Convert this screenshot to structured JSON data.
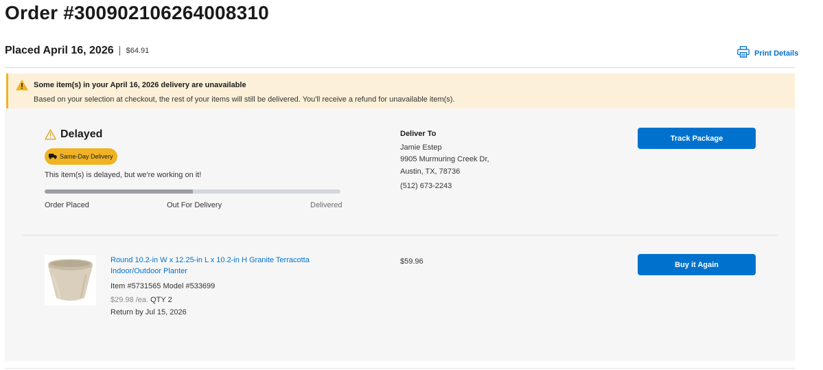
{
  "order": {
    "title": "Order #300902106264008310",
    "placed": "Placed April 16, 2026",
    "total": "$64.91",
    "print_label": "Print Details"
  },
  "banner": {
    "title": "Some item(s) in your April 16, 2026 delivery are unavailable",
    "message": "Based on your selection at checkout, the rest of your items will still be delivered. You'll receive a refund for unavailable item(s)."
  },
  "shipment": {
    "status": "Delayed",
    "badge": "Same-Day Delivery",
    "message": "This item(s) is delayed, but we're working on it!",
    "progress_fraction": 0.5,
    "steps": [
      "Order Placed",
      "Out For Delivery",
      "Delivered"
    ],
    "track_button": "Track Package"
  },
  "deliver_to": {
    "heading": "Deliver To",
    "name": "Jamie Estep",
    "street": "9905 Murmuring Creek Dr,",
    "city": "Austin, TX, 78736",
    "phone": "(512) 673-2243"
  },
  "item": {
    "title": "Round 10.2-in W x 12.25-in L x 10.2-in H Granite Terracotta Indoor/Outdoor Planter",
    "ids": "Item #5731565 Model #533699",
    "unit_price": "$29.98 /ea.",
    "qty": "QTY 2",
    "return_by": "Return by Jul 15, 2026",
    "line_total": "$59.96",
    "buy_again": "Buy it Again",
    "image_icon": "planter-image"
  },
  "icons": {
    "print": "printer-icon",
    "banner": "warning-icon",
    "status": "warning-outline-icon",
    "badge": "truck-icon"
  },
  "colors": {
    "accent": "#0072ce",
    "warning": "#f0b323",
    "banner_bg": "#fcf0d8",
    "panel_bg": "#f6f6f6"
  }
}
